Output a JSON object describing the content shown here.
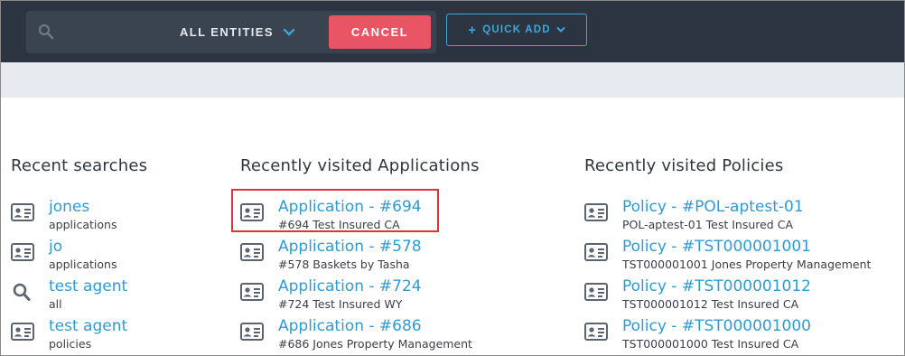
{
  "header": {
    "entity_select": "ALL ENTITIES",
    "cancel_label": "CANCEL",
    "quick_add_label": "QUICK ADD",
    "colors": {
      "bar": "#2c3441",
      "cancel": "#ea5566",
      "accent": "#3aa7de"
    }
  },
  "recent_searches": {
    "title": "Recent searches",
    "items": [
      {
        "title": "jones",
        "sub": "applications",
        "icon": "id-card-icon"
      },
      {
        "title": "jo",
        "sub": "applications",
        "icon": "id-card-icon"
      },
      {
        "title": "test agent",
        "sub": "all",
        "icon": "search-icon"
      },
      {
        "title": "test agent",
        "sub": "policies",
        "icon": "id-card-icon"
      }
    ]
  },
  "recent_applications": {
    "title": "Recently visited Applications",
    "items": [
      {
        "title": "Application - #694",
        "sub": "#694 Test Insured CA"
      },
      {
        "title": "Application - #578",
        "sub": "#578 Baskets by Tasha"
      },
      {
        "title": "Application - #724",
        "sub": "#724 Test Insured WY"
      },
      {
        "title": "Application - #686",
        "sub": "#686 Jones Property Management"
      }
    ]
  },
  "recent_policies": {
    "title": "Recently visited Policies",
    "items": [
      {
        "title": "Policy - #POL-aptest-01",
        "sub": "POL-aptest-01 Test Insured CA"
      },
      {
        "title": "Policy - #TST000001001",
        "sub": "TST000001001 Jones Property Management"
      },
      {
        "title": "Policy - #TST000001012",
        "sub": "TST000001012 Test Insured CA"
      },
      {
        "title": "Policy - #TST000001000",
        "sub": "TST000001000 Test Insured CA"
      }
    ]
  }
}
